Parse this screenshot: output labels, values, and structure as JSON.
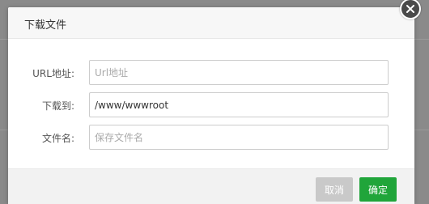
{
  "dialog": {
    "title": "下载文件",
    "close_icon": "close-icon",
    "fields": [
      {
        "label": "URL地址:",
        "value": "",
        "placeholder": "Url地址"
      },
      {
        "label": "下载到:",
        "value": "/www/wwwroot",
        "placeholder": ""
      },
      {
        "label": "文件名:",
        "value": "",
        "placeholder": "保存文件名"
      }
    ],
    "buttons": {
      "cancel": "取消",
      "confirm": "确定"
    }
  },
  "colors": {
    "confirm": "#20a53a",
    "cancel": "#c9c9c9",
    "overlay": "#7f7f7f"
  }
}
